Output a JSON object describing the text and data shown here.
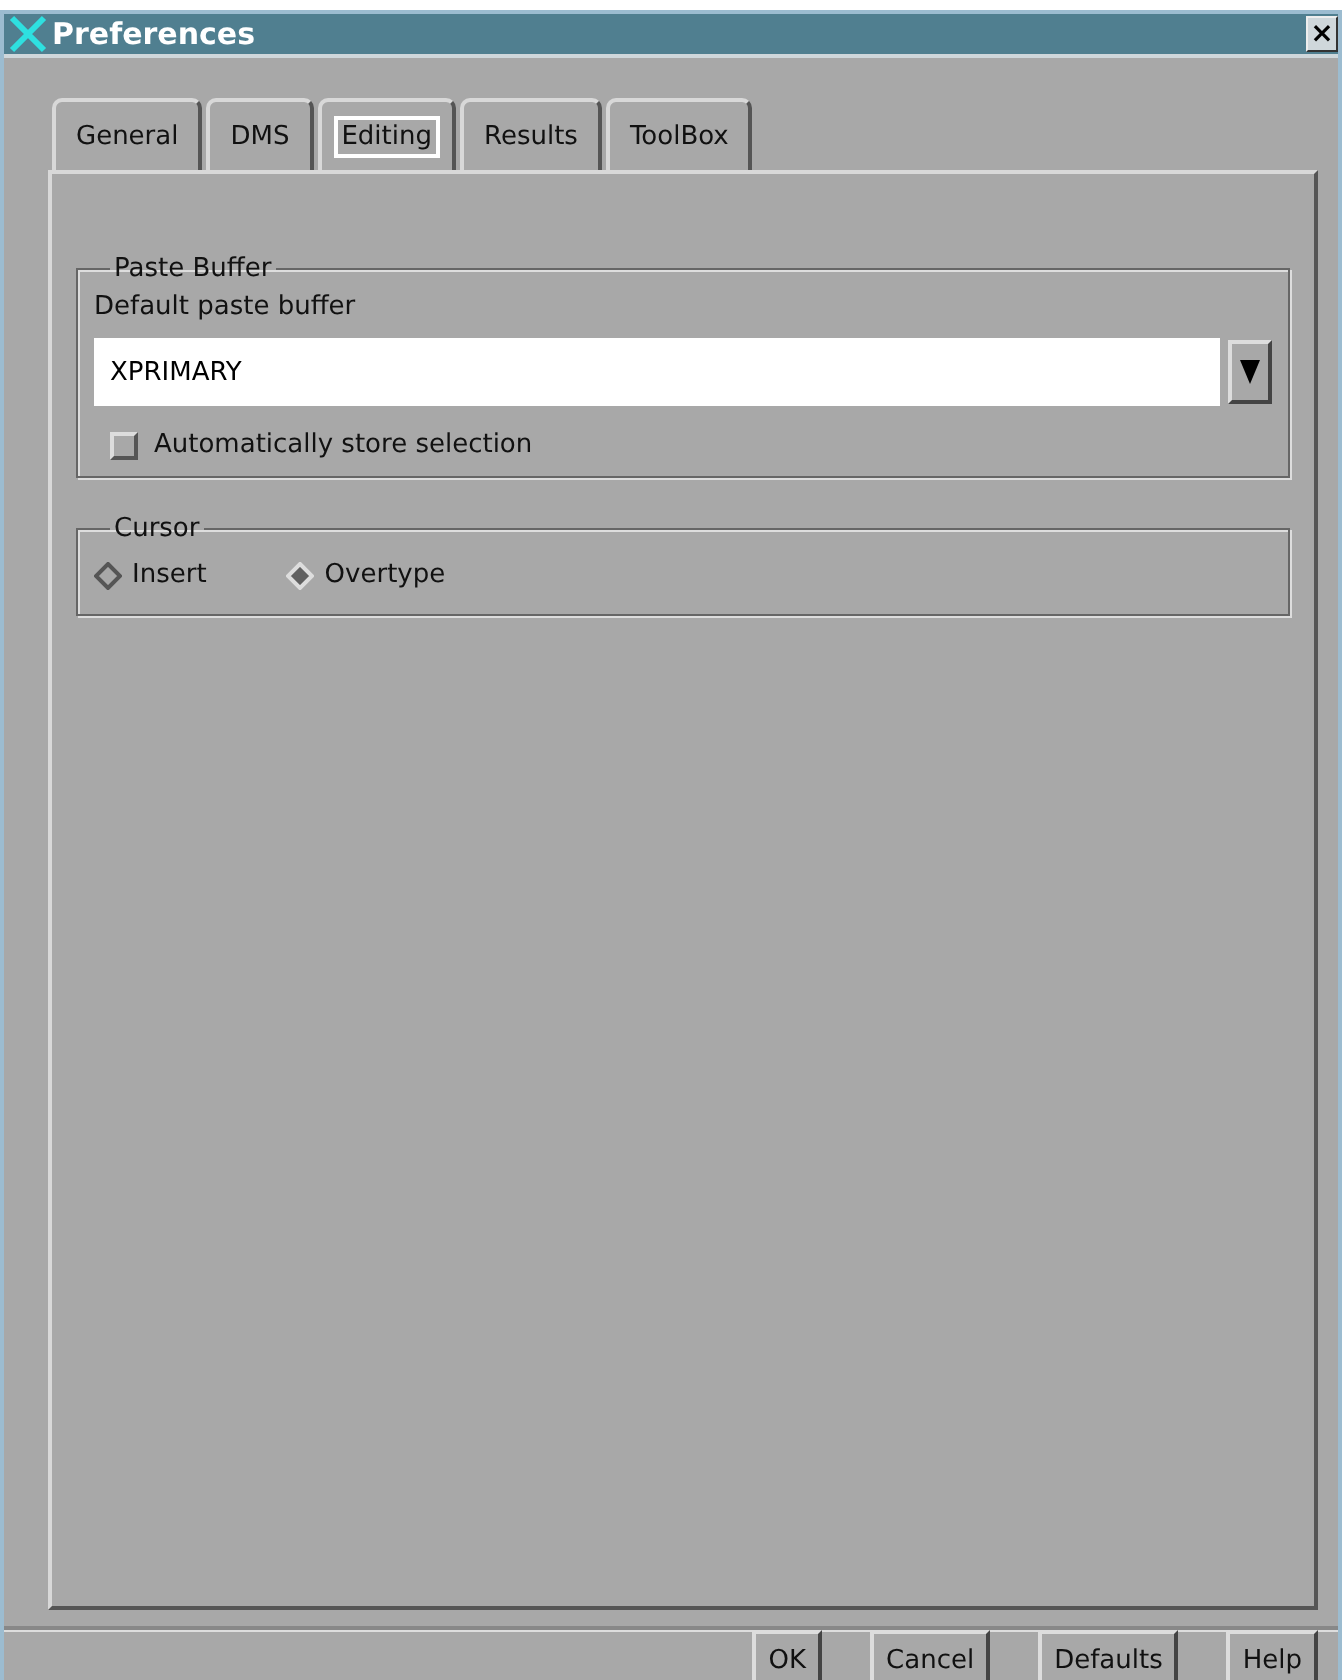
{
  "window": {
    "title": "Preferences",
    "close": "×"
  },
  "tabs": [
    {
      "label": "General",
      "selected": false
    },
    {
      "label": "DMS",
      "selected": false
    },
    {
      "label": "Editing",
      "selected": true
    },
    {
      "label": "Results",
      "selected": false
    },
    {
      "label": "ToolBox",
      "selected": false
    }
  ],
  "paste_buffer": {
    "title": "Paste Buffer",
    "label": "Default paste buffer",
    "value": "XPRIMARY",
    "auto_store": {
      "label": "Automatically store selection",
      "checked": false
    }
  },
  "cursor": {
    "title": "Cursor",
    "options": [
      {
        "label": "Insert",
        "selected": false
      },
      {
        "label": "Overtype",
        "selected": true
      }
    ]
  },
  "buttons": [
    "OK",
    "Cancel",
    "Defaults",
    "Help"
  ]
}
